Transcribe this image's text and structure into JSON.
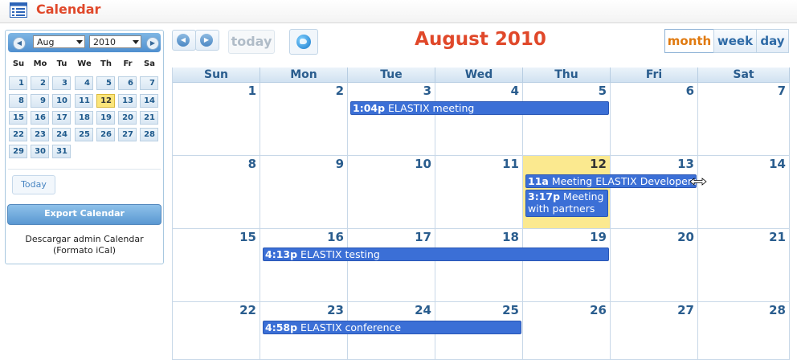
{
  "app": {
    "title": "Calendar",
    "icon": "calendar-list-icon"
  },
  "mini_calendar": {
    "month": "Aug",
    "year": "2010",
    "dow": [
      "Su",
      "Mo",
      "Tu",
      "We",
      "Th",
      "Fr",
      "Sa"
    ],
    "today_label": "Today",
    "days": [
      "1",
      "2",
      "3",
      "4",
      "5",
      "6",
      "7",
      "8",
      "9",
      "10",
      "11",
      "12",
      "13",
      "14",
      "15",
      "16",
      "17",
      "18",
      "19",
      "20",
      "21",
      "22",
      "23",
      "24",
      "25",
      "26",
      "27",
      "28",
      "29",
      "30",
      "31"
    ]
  },
  "export": {
    "title": "Export Calendar",
    "line1": "Descargar admin Calendar",
    "line2": "(Formato iCal)"
  },
  "toolbar": {
    "today_label": "today",
    "title": "August 2010",
    "views": [
      "month",
      "week",
      "day"
    ],
    "active_view": "month"
  },
  "grid": {
    "dow": [
      "Sun",
      "Mon",
      "Tue",
      "Wed",
      "Thu",
      "Fri",
      "Sat"
    ],
    "weeks": [
      [
        "1",
        "2",
        "3",
        "4",
        "5",
        "6",
        "7"
      ],
      [
        "8",
        "9",
        "10",
        "11",
        "12",
        "13",
        "14"
      ],
      [
        "15",
        "16",
        "17",
        "18",
        "19",
        "20",
        "21"
      ],
      [
        "22",
        "23",
        "24",
        "25",
        "26",
        "27",
        "28"
      ]
    ],
    "today": "12"
  },
  "events": [
    {
      "time": "1:04p",
      "title": "ELASTIX meeting"
    },
    {
      "time": "11a",
      "title": "Meeting ELASTIX Developers"
    },
    {
      "time": "3:17p",
      "title": "Meeting with partners"
    },
    {
      "time": "4:13p",
      "title": "ELASTIX testing"
    },
    {
      "time": "4:58p",
      "title": "ELASTIX conference"
    }
  ],
  "colors": {
    "accent": "#e0482a",
    "event": "#3b6fd6",
    "today": "#fbe98f"
  }
}
